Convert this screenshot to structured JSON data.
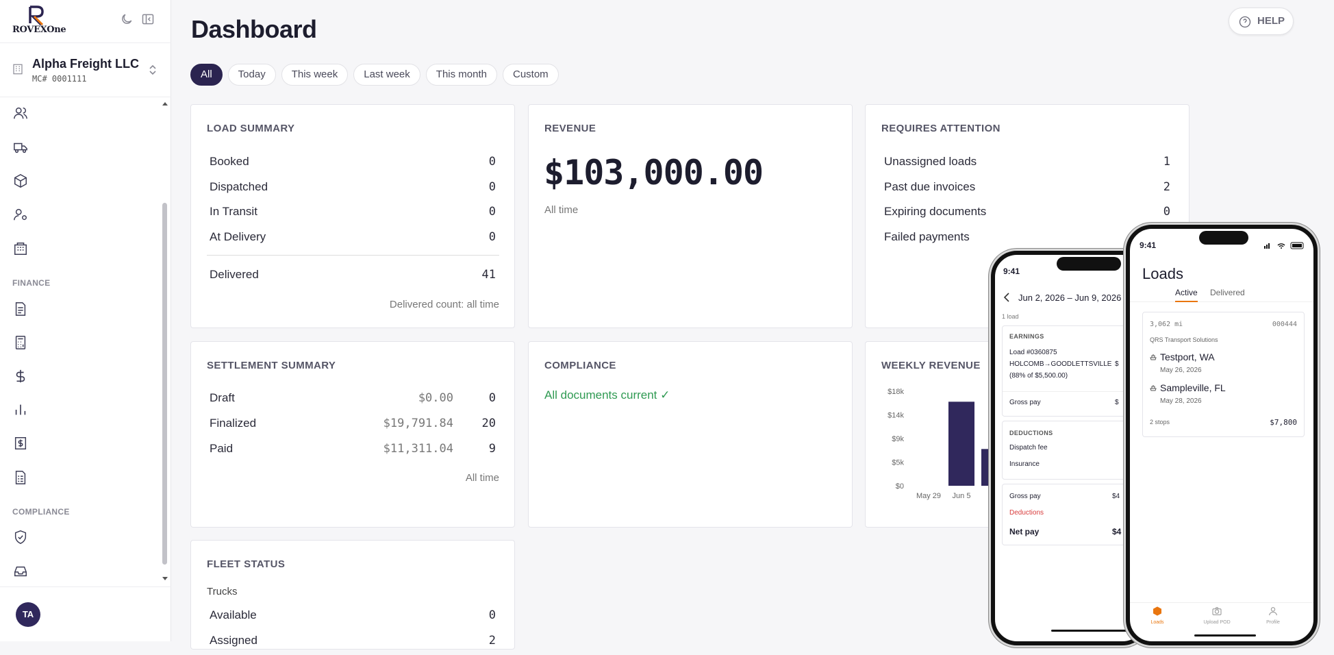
{
  "brand": {
    "logo_text": "ROVEXOne",
    "logo_letter": "R"
  },
  "org": {
    "name": "Alpha Freight LLC",
    "mc": "MC# 0001111"
  },
  "sidebar": {
    "nav_icons": [
      "users-icon",
      "truck-icon",
      "box-icon",
      "user-gear-icon",
      "building-icon"
    ],
    "finance_heading": "FINANCE",
    "finance_icons": [
      "document-icon",
      "calculator-icon",
      "dollar-icon",
      "bar-chart-icon",
      "invoice-icon",
      "receipt-icon"
    ],
    "compliance_heading": "COMPLIANCE",
    "compliance_icons": [
      "shield-check-icon",
      "inbox-icon"
    ],
    "user_initials": "TA"
  },
  "header": {
    "title": "Dashboard",
    "help": "HELP"
  },
  "filters": [
    "All",
    "Today",
    "This week",
    "Last week",
    "This month",
    "Custom"
  ],
  "active_filter": "All",
  "load_summary": {
    "title": "LOAD SUMMARY",
    "rows": [
      {
        "label": "Booked",
        "value": "0"
      },
      {
        "label": "Dispatched",
        "value": "0"
      },
      {
        "label": "In Transit",
        "value": "0"
      },
      {
        "label": "At Delivery",
        "value": "0"
      }
    ],
    "delivered_label": "Delivered",
    "delivered_value": "41",
    "note": "Delivered count: all time"
  },
  "revenue": {
    "title": "REVENUE",
    "amount": "$103,000.00",
    "note": "All time"
  },
  "attention": {
    "title": "REQUIRES ATTENTION",
    "rows": [
      {
        "label": "Unassigned loads",
        "value": "1"
      },
      {
        "label": "Past due invoices",
        "value": "2"
      },
      {
        "label": "Expiring documents",
        "value": "0"
      },
      {
        "label": "Failed payments",
        "value": ""
      }
    ]
  },
  "settlement": {
    "title": "SETTLEMENT SUMMARY",
    "rows": [
      {
        "label": "Draft",
        "amount": "$0.00",
        "count": "0"
      },
      {
        "label": "Finalized",
        "amount": "$19,791.84",
        "count": "20"
      },
      {
        "label": "Paid",
        "amount": "$11,311.04",
        "count": "9"
      }
    ],
    "note": "All time"
  },
  "compliance": {
    "title": "COMPLIANCE",
    "status": "All documents current ✓",
    "status_color": "#2f9a52"
  },
  "weekly": {
    "title": "WEEKLY REVENUE"
  },
  "chart_data": {
    "type": "bar",
    "categories": [
      "May 29",
      "Jun 5",
      "J"
    ],
    "values": [
      0,
      16000,
      7000
    ],
    "yticks": [
      "$18k",
      "$14k",
      "$9k",
      "$5k",
      "$0"
    ],
    "ylim": [
      0,
      18000
    ],
    "color": "#30285c"
  },
  "fleet": {
    "title": "FLEET STATUS",
    "subtitle": "Trucks",
    "rows": [
      {
        "label": "Available",
        "value": "0"
      },
      {
        "label": "Assigned",
        "value": "2"
      }
    ]
  },
  "phone_left": {
    "time": "9:41",
    "range": "Jun 2, 2026 – Jun 9, 2026",
    "count": "1 load",
    "earnings_heading": "EARNINGS",
    "load_line1": "Load #0360875",
    "load_line2": "HOLCOMB→GOODLETTSVILLE",
    "load_line3": "(88% of $5,500.00)",
    "load_amount": "$",
    "gross_label": "Gross pay",
    "gross_value": "$",
    "deductions_heading": "DEDUCTIONS",
    "dispatch_fee": "Dispatch fee",
    "insurance": "Insurance",
    "gross2_label": "Gross pay",
    "gross2_value": "$4",
    "deductions_label": "Deductions",
    "net_label": "Net pay",
    "net_value": "$4"
  },
  "phone_right": {
    "time": "9:41",
    "title": "Loads",
    "tab_active": "Active",
    "tab_other": "Delivered",
    "miles": "3,062 mi",
    "load_no": "000444",
    "company": "QRS Transport Solutions",
    "origin": "Testport, WA",
    "origin_date": "May 26, 2026",
    "dest": "Sampleville, FL",
    "dest_date": "May 28, 2026",
    "stops": "2 stops",
    "price": "$7,800",
    "nav_loads": "Loads",
    "nav_upload": "Upload POD",
    "nav_profile": "Profile",
    "accent": "#e9760f"
  }
}
